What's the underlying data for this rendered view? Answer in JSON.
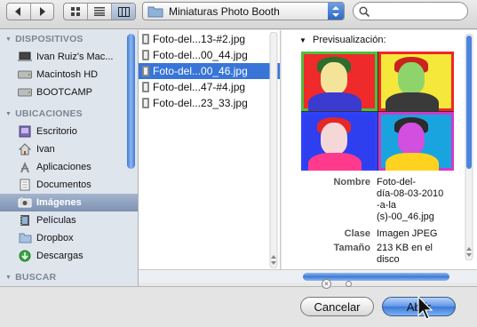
{
  "toolbar": {
    "back_icon": "chevron-left-icon",
    "forward_icon": "chevron-right-icon",
    "view_modes": [
      "icon-view",
      "list-view",
      "column-view"
    ],
    "selected_view": "column-view",
    "location_label": "Miniaturas Photo Booth",
    "search_placeholder": ""
  },
  "sidebar": {
    "sections": [
      {
        "title": "DISPOSITIVOS",
        "items": [
          {
            "label": "Ivan Ruiz's Mac...",
            "icon": "laptop-icon"
          },
          {
            "label": "Macintosh HD",
            "icon": "harddisk-icon"
          },
          {
            "label": "BOOTCAMP",
            "icon": "harddisk-icon"
          }
        ]
      },
      {
        "title": "UBICACIONES",
        "items": [
          {
            "label": "Escritorio",
            "icon": "desktop-icon"
          },
          {
            "label": "Ivan",
            "icon": "home-icon"
          },
          {
            "label": "Aplicaciones",
            "icon": "applications-icon"
          },
          {
            "label": "Documentos",
            "icon": "documents-icon"
          },
          {
            "label": "Imágenes",
            "icon": "pictures-icon",
            "selected": true
          },
          {
            "label": "Películas",
            "icon": "movies-icon"
          },
          {
            "label": "Dropbox",
            "icon": "folder-icon"
          },
          {
            "label": "Descargas",
            "icon": "downloads-icon"
          }
        ]
      },
      {
        "title": "BUSCAR",
        "items": []
      }
    ]
  },
  "files": [
    {
      "name": "Foto-del...13-#2.jpg"
    },
    {
      "name": "Foto-del...00_44.jpg"
    },
    {
      "name": "Foto-del...00_46.jpg",
      "selected": true
    },
    {
      "name": "Foto-del...47-#4.jpg"
    },
    {
      "name": "Foto-del...23_33.jpg"
    }
  ],
  "preview": {
    "heading": "Previsualización:",
    "tile_colors": [
      {
        "bg": "#ee2a2a",
        "skin": "#f4e49a",
        "hair": "#2c6e2c",
        "body": "#3b3bd0",
        "frame": "#4fbf3c"
      },
      {
        "bg": "#f5e83a",
        "skin": "#8fd46b",
        "hair": "#c8231f",
        "body": "#3a3a3a",
        "frame": "#f02626"
      },
      {
        "bg": "#2e3ff0",
        "skin": "#f6d7d7",
        "hair": "#e52727",
        "body": "#ff3a8c",
        "frame": "#3040ff"
      },
      {
        "bg": "#19a4e0",
        "skin": "#d24fdf",
        "hair": "#2b2b2b",
        "body": "#ffd21f",
        "frame": "#cf3ac9"
      }
    ],
    "meta": [
      {
        "label": "Nombre",
        "value_lines": [
          "Foto-del-",
          "día-08-03-2010",
          "-a-la",
          "(s)-00_46.jpg"
        ]
      },
      {
        "label": "Clase",
        "value_lines": [
          "Imagen JPEG"
        ]
      },
      {
        "label": "Tamaño",
        "value_lines": [
          "213 KB en el",
          "disco"
        ]
      }
    ]
  },
  "buttons": {
    "cancel_label": "Cancelar",
    "open_label": "Abrir"
  }
}
